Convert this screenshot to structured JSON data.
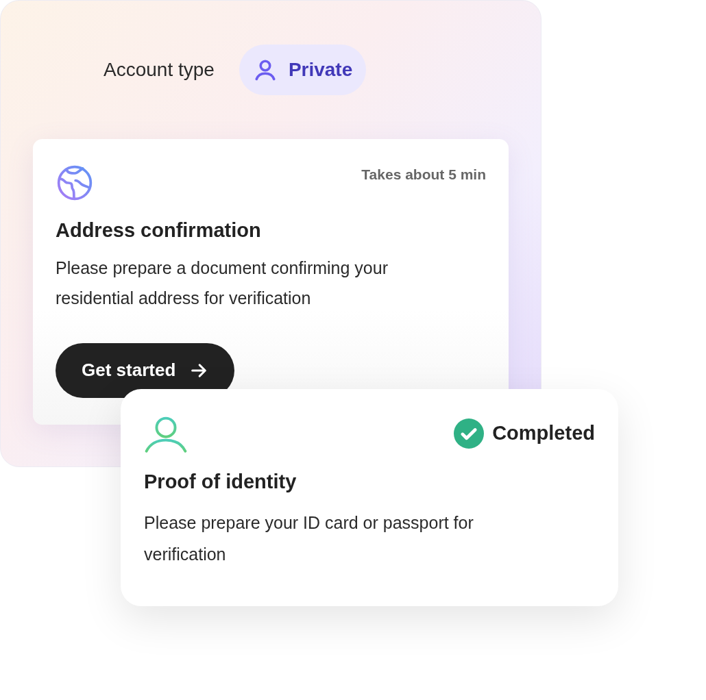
{
  "account_type": {
    "label": "Account type",
    "value": "Private"
  },
  "cards": [
    {
      "kind": "address",
      "completed": false,
      "duration": "Takes about 5 min",
      "title": "Address confirmation",
      "description": "Please prepare a document confirming your residential address for verification",
      "button": "Get started"
    },
    {
      "kind": "identity",
      "completed": true,
      "status": "Completed",
      "title": "Proof of identity",
      "description": "Please prepare your ID card or passport for verification"
    }
  ]
}
